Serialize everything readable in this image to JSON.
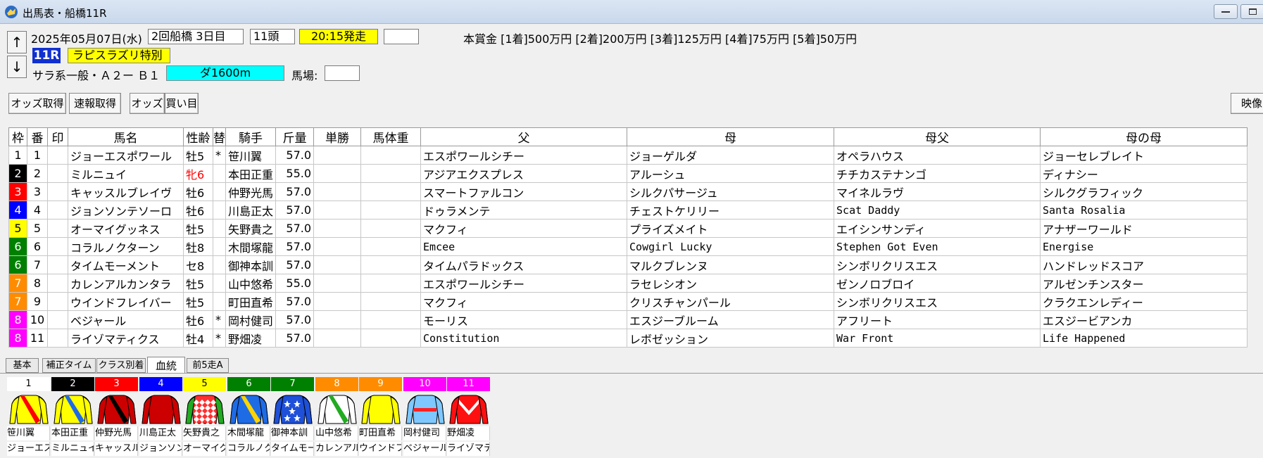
{
  "window": {
    "title": "出馬表・船橋11R"
  },
  "race": {
    "date": "2025年05月07日(水)",
    "meeting": "2回船橋 3日目",
    "heads": "11頭",
    "post_time": "20:15発走",
    "race_no": "11R",
    "name": "ラピスラズリ特別",
    "class": "サラ系一般・Ａ２ー Ｂ１",
    "course": "ダ1600m",
    "baba_label": "馬場:",
    "prize": "本賞金 [1着]500万円 [2着]200万円 [3着]125万円 [4着]75万円 [5着]50万円"
  },
  "toolbar": {
    "odds_fetch": "オッズ取得",
    "flash_fetch": "速報取得",
    "odds": "オッズ",
    "bets": "買い目",
    "video": "映像"
  },
  "table": {
    "headers": [
      "枠",
      "番",
      "印",
      "馬名",
      "性齢",
      "替",
      "騎手",
      "斤量",
      "単勝",
      "馬体重",
      "父",
      "母",
      "母父",
      "母の母"
    ],
    "rows": [
      {
        "waku": "1",
        "num": "1",
        "name": "ジョーエスポワール",
        "sexage": "牡5",
        "kae": "*",
        "jockey": "笹川翼",
        "kin": "57.0",
        "sire": "エスポワールシチー",
        "dam": "ジョーゲルダ",
        "damsire": "オペラハウス",
        "damdam": "ジョーセレブレイト"
      },
      {
        "waku": "2",
        "num": "2",
        "name": "ミルニュイ",
        "sexage": "牝6",
        "kae": "",
        "jockey": "本田正重",
        "kin": "55.0",
        "sire": "アジアエクスプレス",
        "dam": "アルーシュ",
        "damsire": "チチカステナンゴ",
        "damdam": "ディナシー"
      },
      {
        "waku": "3",
        "num": "3",
        "name": "キャッスルブレイヴ",
        "sexage": "牡6",
        "kae": "",
        "jockey": "仲野光馬",
        "kin": "57.0",
        "sire": "スマートファルコン",
        "dam": "シルクパサージュ",
        "damsire": "マイネルラヴ",
        "damdam": "シルクグラフィック"
      },
      {
        "waku": "4",
        "num": "4",
        "name": "ジョンソンテソーロ",
        "sexage": "牡6",
        "kae": "",
        "jockey": "川島正太",
        "kin": "57.0",
        "sire": "ドゥラメンテ",
        "dam": "チェストケリリー",
        "damsire": "Scat Daddy",
        "damdam": "Santa Rosalia"
      },
      {
        "waku": "5",
        "num": "5",
        "name": "オーマイグッネス",
        "sexage": "牡5",
        "kae": "",
        "jockey": "矢野貴之",
        "kin": "57.0",
        "sire": "マクフィ",
        "dam": "プライズメイト",
        "damsire": "エイシンサンディ",
        "damdam": "アナザーワールド"
      },
      {
        "waku": "6",
        "num": "6",
        "name": "コラルノクターン",
        "sexage": "牡8",
        "kae": "",
        "jockey": "木間塚龍",
        "kin": "57.0",
        "sire": "Emcee",
        "dam": "Cowgirl Lucky",
        "damsire": "Stephen Got Even",
        "damdam": "Energise"
      },
      {
        "waku": "6",
        "num": "7",
        "name": "タイムモーメント",
        "sexage": "セ8",
        "kae": "",
        "jockey": "御神本訓",
        "kin": "57.0",
        "sire": "タイムパラドックス",
        "dam": "マルクブレンヌ",
        "damsire": "シンボリクリスエス",
        "damdam": "ハンドレッドスコア"
      },
      {
        "waku": "7",
        "num": "8",
        "name": "カレンアルカンタラ",
        "sexage": "牡5",
        "kae": "",
        "jockey": "山中悠希",
        "kin": "55.0",
        "sire": "エスポワールシチー",
        "dam": "ラセレシオン",
        "damsire": "ゼンノロブロイ",
        "damdam": "アルゼンチンスター"
      },
      {
        "waku": "7",
        "num": "9",
        "name": "ウインドフレイバー",
        "sexage": "牡5",
        "kae": "",
        "jockey": "町田直希",
        "kin": "57.0",
        "sire": "マクフィ",
        "dam": "クリスチャンパール",
        "damsire": "シンボリクリスエス",
        "damdam": "クラクエンレディー"
      },
      {
        "waku": "8",
        "num": "10",
        "name": "ベジャール",
        "sexage": "牡6",
        "kae": "*",
        "jockey": "岡村健司",
        "kin": "57.0",
        "sire": "モーリス",
        "dam": "エスジーブルーム",
        "damsire": "アフリート",
        "damdam": "エスジービアンカ"
      },
      {
        "waku": "8",
        "num": "11",
        "name": "ライゾマティクス",
        "sexage": "牡4",
        "kae": "*",
        "jockey": "野畑凌",
        "kin": "57.0",
        "sire": "Constitution",
        "dam": "レボゼッション",
        "damsire": "War Front",
        "damdam": "Life Happened"
      }
    ]
  },
  "tabs": [
    "基本",
    "補正タイム",
    "クラス別着",
    "血統",
    "前5走A"
  ],
  "silks": [
    {
      "num": "1",
      "jockey": "笹川翼",
      "horse": "ジョーエスポワール"
    },
    {
      "num": "2",
      "jockey": "本田正重",
      "horse": "ミルニュイ"
    },
    {
      "num": "3",
      "jockey": "仲野光馬",
      "horse": "キャッスルブレイヴ"
    },
    {
      "num": "4",
      "jockey": "川島正太",
      "horse": "ジョンソンテソーロ"
    },
    {
      "num": "5",
      "jockey": "矢野貴之",
      "horse": "オーマイグッネス"
    },
    {
      "num": "6",
      "jockey": "木間塚龍",
      "horse": "コラルノクターン"
    },
    {
      "num": "7",
      "jockey": "御神本訓",
      "horse": "タイムモーメント"
    },
    {
      "num": "8",
      "jockey": "山中悠希",
      "horse": "カレンアルカンタラ"
    },
    {
      "num": "9",
      "jockey": "町田直希",
      "horse": "ウインドフレイバー"
    },
    {
      "num": "10",
      "jockey": "岡村健司",
      "horse": "ベジャール"
    },
    {
      "num": "11",
      "jockey": "野畑凌",
      "horse": "ライゾマティクス"
    }
  ],
  "colors": {
    "waku": {
      "1": "#ffffff",
      "2": "#000000",
      "3": "#ff0000",
      "4": "#0000ff",
      "5": "#ffff00",
      "6": "#008000",
      "7": "#ff8c00",
      "8": "#ff00ff"
    },
    "waku_text": {
      "1": "#000000",
      "2": "#ffffff",
      "3": "#ffffff",
      "4": "#ffffff",
      "5": "#000000",
      "6": "#ffffff",
      "7": "#ffffff",
      "8": "#ffffff"
    },
    "filly": "#ff0000",
    "race_badge": "#1030d0",
    "race_name_bg": "#ffff00",
    "post_time_bg": "#ffff00",
    "course_bg": "#00ffff"
  }
}
